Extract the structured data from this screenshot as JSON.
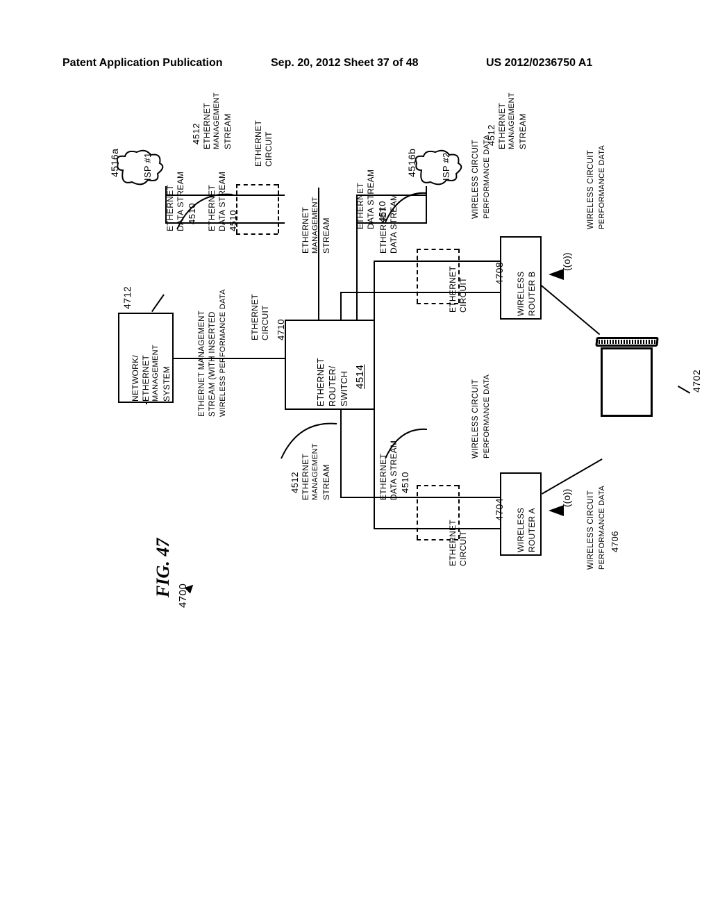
{
  "header": {
    "left": "Patent Application Publication",
    "center": "Sep. 20, 2012  Sheet 37 of 48",
    "right": "US 2012/0236750 A1"
  },
  "figure": {
    "title": "FIG. 47",
    "main_ref": "4700"
  },
  "labels": {
    "net_mgmt_sys": "NETWORK/\nETHERNET\nMANAGEMENT\nSYSTEM",
    "net_mgmt_sys_ref": "4712",
    "mgmt_stream_inserted": "ETHERNET MANAGEMENT\nSTREAM (WITH INSERTED\nWIRELESS PERFORMANCE DATA",
    "eth_data_stream": "ETHERNET\nDATA STREAM",
    "eth_data_stream_ref": "4510",
    "eth_mgmt_stream": "ETHERNET\nMANAGEMENT\nSTREAM",
    "eth_mgmt_stream_ref": "4512",
    "eth_circuit": "ETHERNET\nCIRCUIT",
    "eth_circuit_ref": "4710",
    "eth_router_switch": "ETHERNET\nROUTER/\nSWITCH",
    "eth_router_switch_ref": "4514",
    "isp1": "ISP #1",
    "isp1_ref": "4516a",
    "isp2": "ISP #2",
    "isp2_ref": "4516b",
    "wireless_router_a": "WIRELESS\nROUTER A",
    "wireless_router_a_ref": "4704",
    "wireless_router_b": "WIRELESS\nROUTER B",
    "wireless_router_b_ref": "4708",
    "wcpd": "WIRELESS CIRCUIT\nPERFORMANCE DATA",
    "wcpd_ref": "4706",
    "laptop_ref": "4702",
    "antenna": "((o))"
  }
}
